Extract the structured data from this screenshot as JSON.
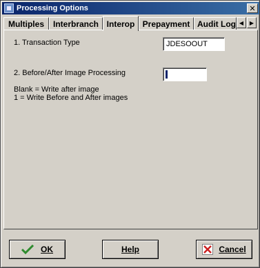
{
  "window": {
    "title": "Processing Options",
    "close_glyph": "✕"
  },
  "tabs": [
    {
      "label": "Multiples"
    },
    {
      "label": "Interbranch"
    },
    {
      "label": "Interop"
    },
    {
      "label": "Prepayment"
    },
    {
      "label": "Audit Log"
    }
  ],
  "tab_scroll": {
    "left": "◀",
    "right": "▶"
  },
  "options": {
    "transaction_type": {
      "label": "1. Transaction Type",
      "value": "JDESOOUT"
    },
    "image_processing": {
      "label": "2. Before/After Image Processing",
      "value": ""
    },
    "help_line_1": "Blank = Write after image",
    "help_line_2": "1 = Write Before and After images"
  },
  "buttons": {
    "ok": {
      "label": "OK",
      "icon": "check-icon"
    },
    "help": {
      "label": "Help"
    },
    "cancel": {
      "label": "Cancel",
      "icon": "x-icon"
    }
  },
  "colors": {
    "titlebar_start": "#0a246a",
    "titlebar_end": "#3a6ea5",
    "face": "#d4d0c8",
    "check": "#2e8b2e",
    "x": "#cc2020"
  }
}
